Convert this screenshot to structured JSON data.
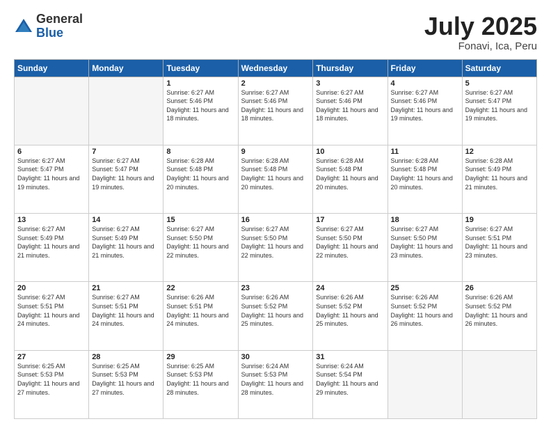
{
  "header": {
    "logo_general": "General",
    "logo_blue": "Blue",
    "title": "July 2025",
    "location": "Fonavi, Ica, Peru"
  },
  "weekdays": [
    "Sunday",
    "Monday",
    "Tuesday",
    "Wednesday",
    "Thursday",
    "Friday",
    "Saturday"
  ],
  "weeks": [
    [
      {
        "day": null,
        "sunrise": null,
        "sunset": null,
        "daylight": null
      },
      {
        "day": null,
        "sunrise": null,
        "sunset": null,
        "daylight": null
      },
      {
        "day": "1",
        "sunrise": "Sunrise: 6:27 AM",
        "sunset": "Sunset: 5:46 PM",
        "daylight": "Daylight: 11 hours and 18 minutes."
      },
      {
        "day": "2",
        "sunrise": "Sunrise: 6:27 AM",
        "sunset": "Sunset: 5:46 PM",
        "daylight": "Daylight: 11 hours and 18 minutes."
      },
      {
        "day": "3",
        "sunrise": "Sunrise: 6:27 AM",
        "sunset": "Sunset: 5:46 PM",
        "daylight": "Daylight: 11 hours and 18 minutes."
      },
      {
        "day": "4",
        "sunrise": "Sunrise: 6:27 AM",
        "sunset": "Sunset: 5:46 PM",
        "daylight": "Daylight: 11 hours and 19 minutes."
      },
      {
        "day": "5",
        "sunrise": "Sunrise: 6:27 AM",
        "sunset": "Sunset: 5:47 PM",
        "daylight": "Daylight: 11 hours and 19 minutes."
      }
    ],
    [
      {
        "day": "6",
        "sunrise": "Sunrise: 6:27 AM",
        "sunset": "Sunset: 5:47 PM",
        "daylight": "Daylight: 11 hours and 19 minutes."
      },
      {
        "day": "7",
        "sunrise": "Sunrise: 6:27 AM",
        "sunset": "Sunset: 5:47 PM",
        "daylight": "Daylight: 11 hours and 19 minutes."
      },
      {
        "day": "8",
        "sunrise": "Sunrise: 6:28 AM",
        "sunset": "Sunset: 5:48 PM",
        "daylight": "Daylight: 11 hours and 20 minutes."
      },
      {
        "day": "9",
        "sunrise": "Sunrise: 6:28 AM",
        "sunset": "Sunset: 5:48 PM",
        "daylight": "Daylight: 11 hours and 20 minutes."
      },
      {
        "day": "10",
        "sunrise": "Sunrise: 6:28 AM",
        "sunset": "Sunset: 5:48 PM",
        "daylight": "Daylight: 11 hours and 20 minutes."
      },
      {
        "day": "11",
        "sunrise": "Sunrise: 6:28 AM",
        "sunset": "Sunset: 5:48 PM",
        "daylight": "Daylight: 11 hours and 20 minutes."
      },
      {
        "day": "12",
        "sunrise": "Sunrise: 6:28 AM",
        "sunset": "Sunset: 5:49 PM",
        "daylight": "Daylight: 11 hours and 21 minutes."
      }
    ],
    [
      {
        "day": "13",
        "sunrise": "Sunrise: 6:27 AM",
        "sunset": "Sunset: 5:49 PM",
        "daylight": "Daylight: 11 hours and 21 minutes."
      },
      {
        "day": "14",
        "sunrise": "Sunrise: 6:27 AM",
        "sunset": "Sunset: 5:49 PM",
        "daylight": "Daylight: 11 hours and 21 minutes."
      },
      {
        "day": "15",
        "sunrise": "Sunrise: 6:27 AM",
        "sunset": "Sunset: 5:50 PM",
        "daylight": "Daylight: 11 hours and 22 minutes."
      },
      {
        "day": "16",
        "sunrise": "Sunrise: 6:27 AM",
        "sunset": "Sunset: 5:50 PM",
        "daylight": "Daylight: 11 hours and 22 minutes."
      },
      {
        "day": "17",
        "sunrise": "Sunrise: 6:27 AM",
        "sunset": "Sunset: 5:50 PM",
        "daylight": "Daylight: 11 hours and 22 minutes."
      },
      {
        "day": "18",
        "sunrise": "Sunrise: 6:27 AM",
        "sunset": "Sunset: 5:50 PM",
        "daylight": "Daylight: 11 hours and 23 minutes."
      },
      {
        "day": "19",
        "sunrise": "Sunrise: 6:27 AM",
        "sunset": "Sunset: 5:51 PM",
        "daylight": "Daylight: 11 hours and 23 minutes."
      }
    ],
    [
      {
        "day": "20",
        "sunrise": "Sunrise: 6:27 AM",
        "sunset": "Sunset: 5:51 PM",
        "daylight": "Daylight: 11 hours and 24 minutes."
      },
      {
        "day": "21",
        "sunrise": "Sunrise: 6:27 AM",
        "sunset": "Sunset: 5:51 PM",
        "daylight": "Daylight: 11 hours and 24 minutes."
      },
      {
        "day": "22",
        "sunrise": "Sunrise: 6:26 AM",
        "sunset": "Sunset: 5:51 PM",
        "daylight": "Daylight: 11 hours and 24 minutes."
      },
      {
        "day": "23",
        "sunrise": "Sunrise: 6:26 AM",
        "sunset": "Sunset: 5:52 PM",
        "daylight": "Daylight: 11 hours and 25 minutes."
      },
      {
        "day": "24",
        "sunrise": "Sunrise: 6:26 AM",
        "sunset": "Sunset: 5:52 PM",
        "daylight": "Daylight: 11 hours and 25 minutes."
      },
      {
        "day": "25",
        "sunrise": "Sunrise: 6:26 AM",
        "sunset": "Sunset: 5:52 PM",
        "daylight": "Daylight: 11 hours and 26 minutes."
      },
      {
        "day": "26",
        "sunrise": "Sunrise: 6:26 AM",
        "sunset": "Sunset: 5:52 PM",
        "daylight": "Daylight: 11 hours and 26 minutes."
      }
    ],
    [
      {
        "day": "27",
        "sunrise": "Sunrise: 6:25 AM",
        "sunset": "Sunset: 5:53 PM",
        "daylight": "Daylight: 11 hours and 27 minutes."
      },
      {
        "day": "28",
        "sunrise": "Sunrise: 6:25 AM",
        "sunset": "Sunset: 5:53 PM",
        "daylight": "Daylight: 11 hours and 27 minutes."
      },
      {
        "day": "29",
        "sunrise": "Sunrise: 6:25 AM",
        "sunset": "Sunset: 5:53 PM",
        "daylight": "Daylight: 11 hours and 28 minutes."
      },
      {
        "day": "30",
        "sunrise": "Sunrise: 6:24 AM",
        "sunset": "Sunset: 5:53 PM",
        "daylight": "Daylight: 11 hours and 28 minutes."
      },
      {
        "day": "31",
        "sunrise": "Sunrise: 6:24 AM",
        "sunset": "Sunset: 5:54 PM",
        "daylight": "Daylight: 11 hours and 29 minutes."
      },
      {
        "day": null,
        "sunrise": null,
        "sunset": null,
        "daylight": null
      },
      {
        "day": null,
        "sunrise": null,
        "sunset": null,
        "daylight": null
      }
    ]
  ]
}
